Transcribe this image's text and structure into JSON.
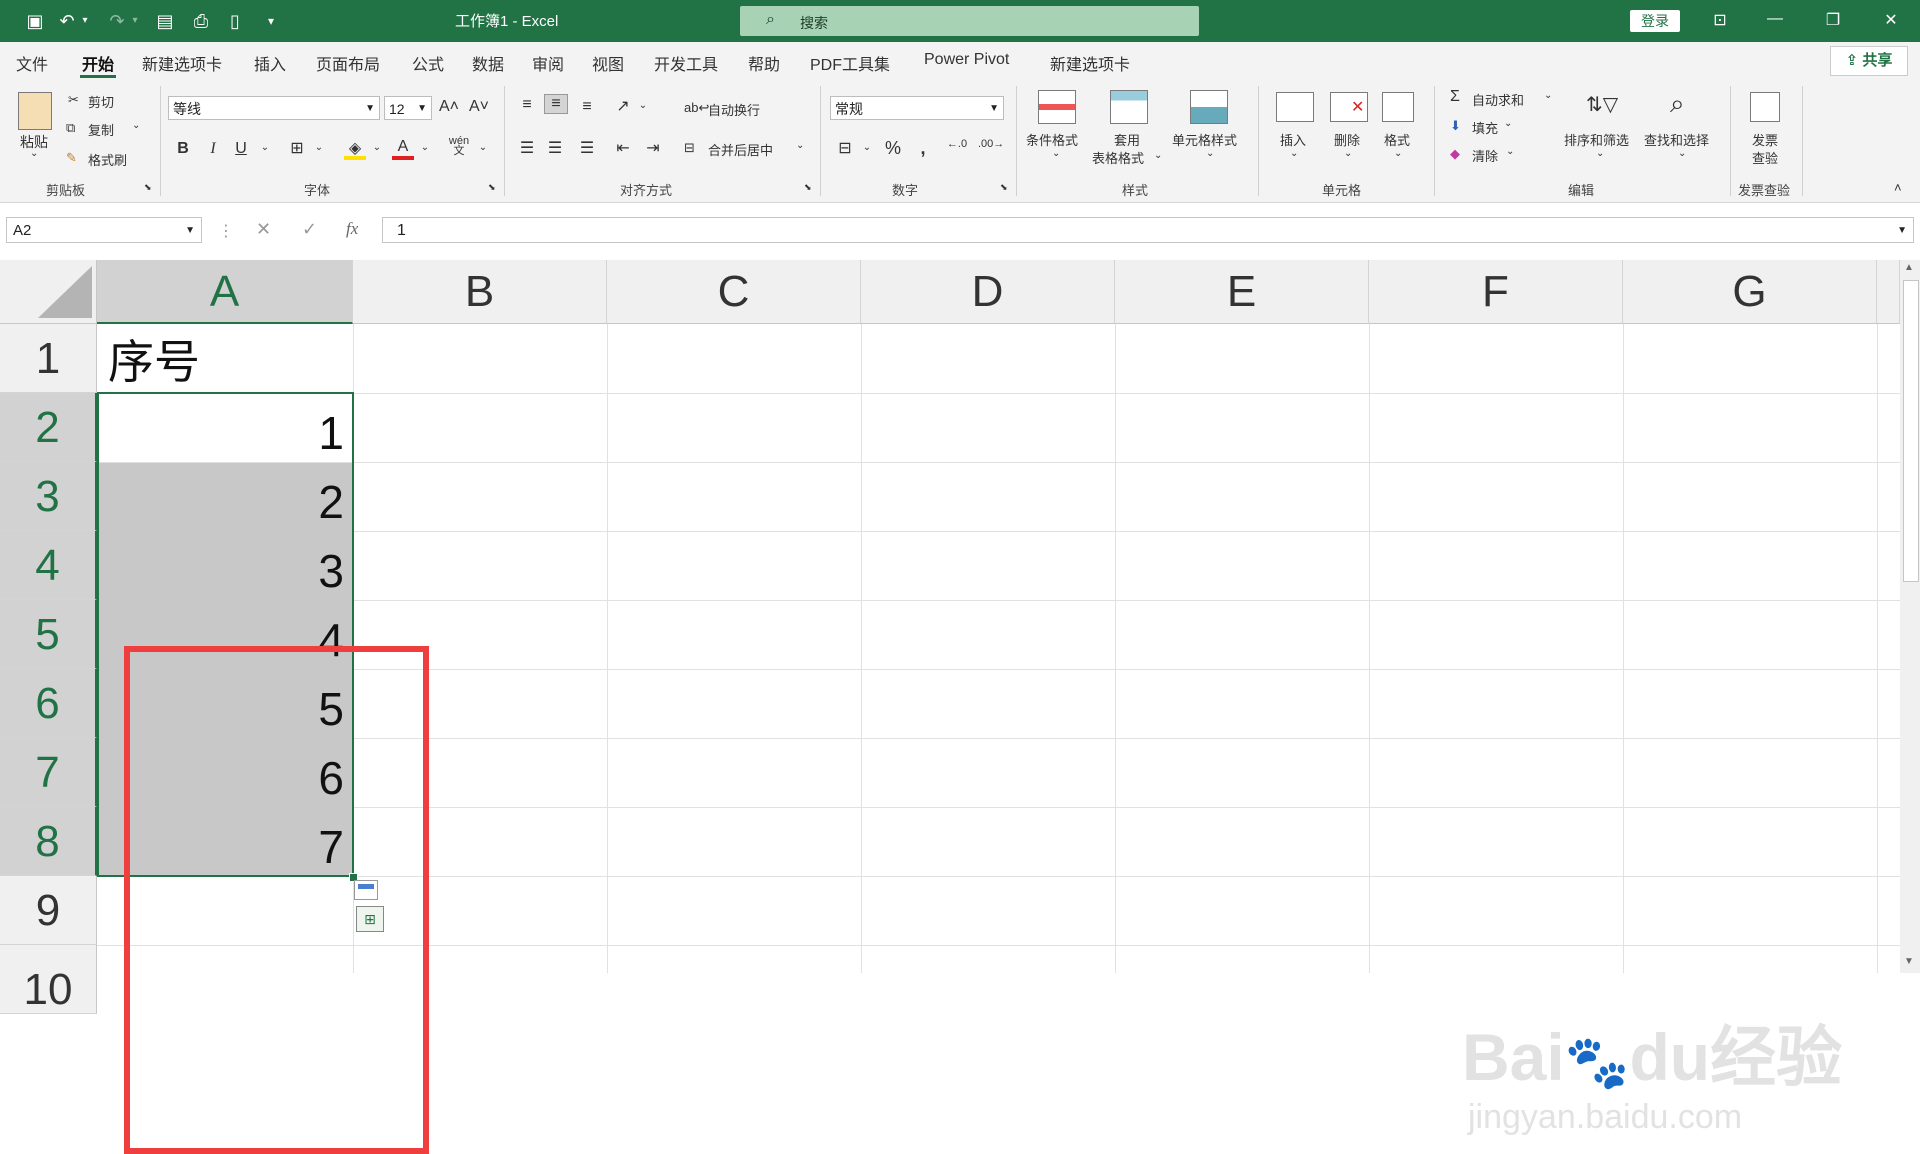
{
  "titlebar": {
    "title": "工作簿1  -  Excel",
    "search_placeholder": "搜索",
    "login": "登录",
    "bg_color": "#217346"
  },
  "menu": {
    "items": [
      "文件",
      "开始",
      "新建选项卡",
      "插入",
      "页面布局",
      "公式",
      "数据",
      "审阅",
      "视图",
      "开发工具",
      "帮助",
      "PDF工具集",
      "Power Pivot",
      "新建选项卡"
    ],
    "active": "开始",
    "share": "共享"
  },
  "ribbon": {
    "clipboard": {
      "paste": "粘贴",
      "cut": "剪切",
      "copy": "复制",
      "format_painter": "格式刷",
      "label": "剪贴板"
    },
    "font": {
      "name": "等线",
      "size": "12",
      "bold": "B",
      "italic": "I",
      "underline": "U",
      "label": "字体"
    },
    "alignment": {
      "wrap": "自动换行",
      "merge": "合并后居中",
      "label": "对齐方式"
    },
    "number": {
      "format": "常规",
      "label": "数字"
    },
    "styles": {
      "conditional": "条件格式",
      "table_1": "套用",
      "table_2": "表格格式",
      "cell_styles": "单元格样式",
      "label": "样式"
    },
    "cells": {
      "insert": "插入",
      "delete": "删除",
      "format": "格式",
      "label": "单元格"
    },
    "editing": {
      "autosum": "自动求和",
      "fill": "填充",
      "clear": "清除",
      "sort": "排序和筛选",
      "find": "查找和选择",
      "label": "编辑"
    },
    "invoice": {
      "line1": "发票",
      "line2": "查验",
      "label": "发票查验"
    }
  },
  "formula_bar": {
    "name_box": "A2",
    "formula": "1",
    "fx": "fx"
  },
  "sheet": {
    "columns": [
      "A",
      "B",
      "C",
      "D",
      "E",
      "F",
      "G"
    ],
    "rows": [
      "1",
      "2",
      "3",
      "4",
      "5",
      "6",
      "7",
      "8",
      "9",
      "10"
    ],
    "a1": "序号",
    "a_values": [
      "1",
      "2",
      "3",
      "4",
      "5",
      "6",
      "7"
    ],
    "highlight_color": "#ef3e3e"
  },
  "watermark": {
    "line1": "Bai",
    "line1b": "du",
    "line1c": "经验",
    "line2": "jingyan.baidu.com"
  }
}
